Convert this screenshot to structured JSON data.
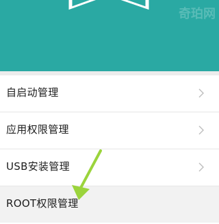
{
  "colors": {
    "header": "#2aa9a3",
    "arrow": "#9bd43c"
  },
  "settings_list": {
    "items": [
      {
        "label": "自启动管理",
        "icon": "chevron-right-icon"
      },
      {
        "label": "应用权限管理",
        "icon": "chevron-right-icon"
      },
      {
        "label": "USB安装管理",
        "icon": "chevron-right-icon"
      },
      {
        "label": "ROOT权限管理",
        "icon": "chevron-right-icon"
      }
    ]
  },
  "watermark": {
    "text": "奇珀网"
  }
}
